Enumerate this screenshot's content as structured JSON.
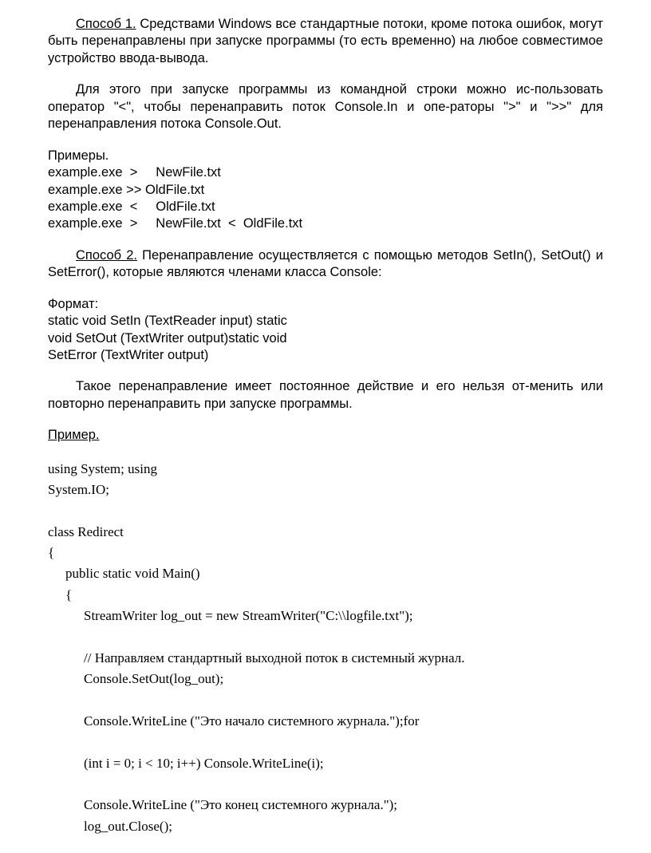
{
  "p1_label": "Способ 1.",
  "p1_after": " Средствами Windows все стандартные потоки, кроме потока ошибок, могут быть перенаправлены при запуске программы (то есть временно) на любое совместимое устройство ввода-вывода.",
  "p2": "Для этого при запуске программы из командной строки можно ис-пользовать оператор \"<\", чтобы перенаправить поток Console.In и опе-раторы \">\" и \">>\"  для перенаправления потока Console.Out.",
  "ex_header": "Примеры.",
  "ex_lines": "example.exe  >     NewFile.txt\nexample.exe >> OldFile.txt\nexample.exe  <     OldFile.txt\nexample.exe  >     NewFile.txt  <  OldFile.txt",
  "p3_label": "Способ 2.",
  "p3_after": " Перенаправление осуществляется с помощью методов SetIn(), SetOut() и SetError(), которые являются членами класса Console:",
  "fmt_header": "Формат:",
  "fmt_lines": "static void SetIn (TextReader input) static\nvoid SetOut (TextWriter output)static void\nSetError (TextWriter output)",
  "p4": "Такое перенаправление имеет постоянное действие и его нельзя от-менить или повторно перенаправить при запуске программы.",
  "example_label": "Пример.",
  "code": {
    "l1": "using System; using",
    "l2": "System.IO;",
    "l3": "class Redirect",
    "l4": "{",
    "l5": "public static void Main()",
    "l6": "{",
    "l7": "StreamWriter log_out = new StreamWriter(\"C:\\\\logfile.txt\");",
    "l8": "// Направляем стандартный выходной поток в системный журнал.",
    "l9": "Console.SetOut(log_out);",
    "l10": "Console.WriteLine (\"Это начало системного журнала.\");for",
    "l11": "(int i = 0; i < 10; i++)  Console.WriteLine(i);",
    "l12": "Console.WriteLine (\"Это конец системного журнала.\");",
    "l13": "log_out.Close();"
  }
}
